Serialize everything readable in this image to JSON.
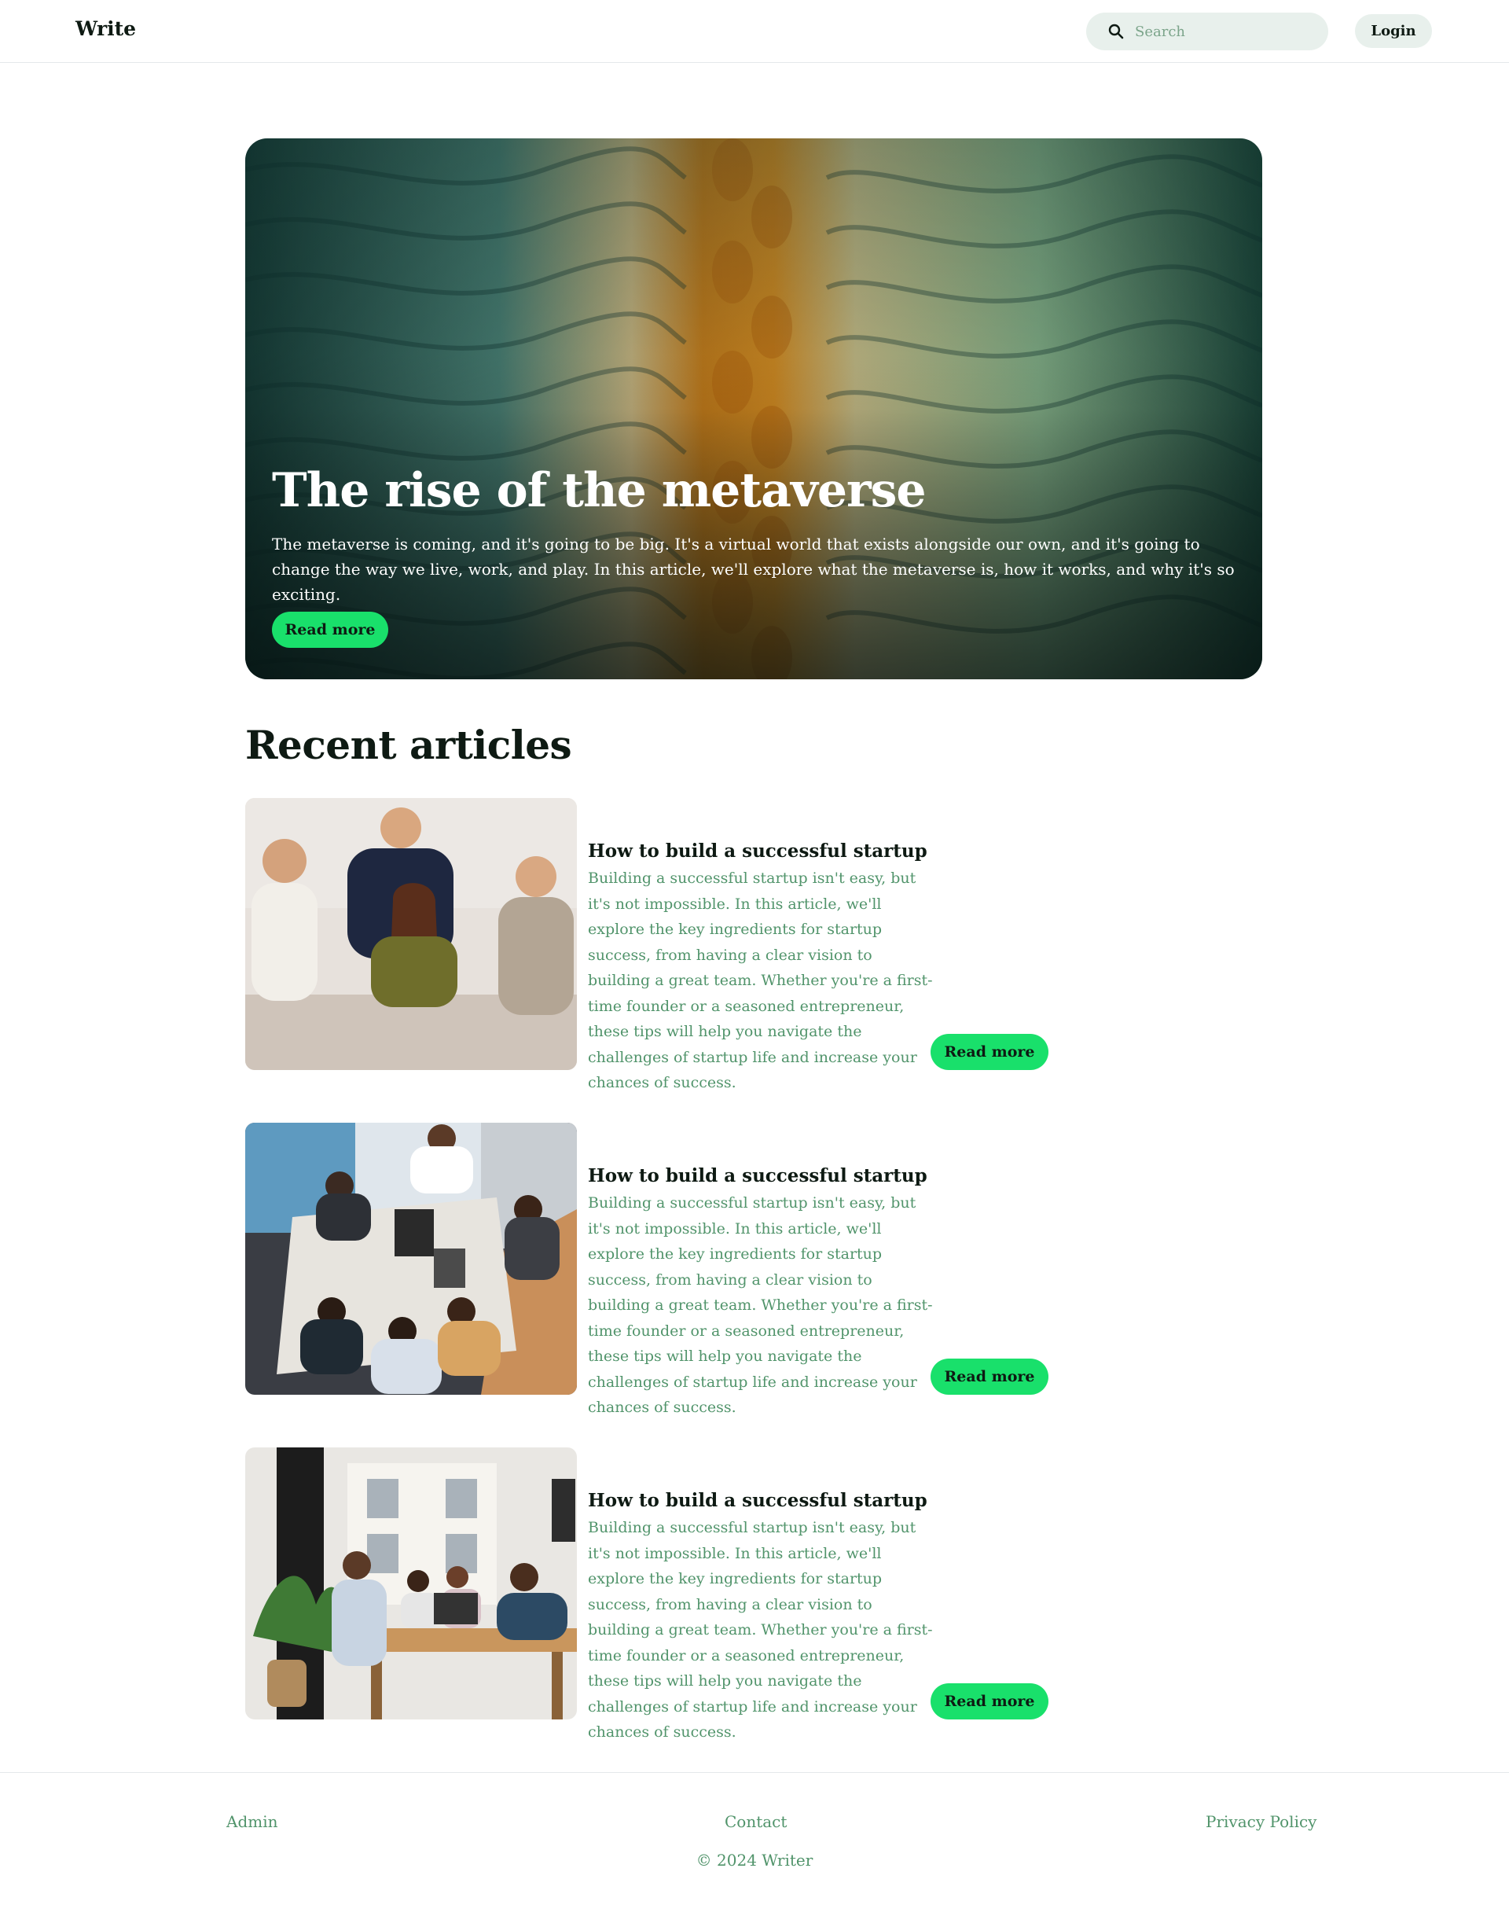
{
  "header": {
    "logo": "Write",
    "search_placeholder": "Search",
    "login_label": "Login"
  },
  "hero": {
    "title": "The rise of the metaverse",
    "description": "The metaverse is coming, and it's going to be big. It's a virtual world that exists alongside our own, and it's going to change the way we live, work, and play. In this article, we'll explore what the metaverse is, how it works, and why it's so exciting.",
    "button_label": "Read more"
  },
  "recent": {
    "heading": "Recent articles",
    "articles": [
      {
        "title": "How to build a successful startup",
        "body": "Building a successful startup isn't easy, but it's not impossible. In this article, we'll explore the key ingredients for startup success, from having a clear vision to building a great team. Whether you're a first-time founder or a seasoned entrepreneur, these tips will help you navigate the challenges of startup life and increase your chances of success.",
        "button_label": "Read more"
      },
      {
        "title": "How to build a successful startup",
        "body": "Building a successful startup isn't easy, but it's not impossible. In this article, we'll explore the key ingredients for startup success, from having a clear vision to building a great team. Whether you're a first-time founder or a seasoned entrepreneur, these tips will help you navigate the challenges of startup life and increase your chances of success.",
        "button_label": "Read more"
      },
      {
        "title": "How to build a successful startup",
        "body": "Building a successful startup isn't easy, but it's not impossible. In this article, we'll explore the key ingredients for startup success, from having a clear vision to building a great team. Whether you're a first-time founder or a seasoned entrepreneur, these tips will help you navigate the challenges of startup life and increase your chances of success.",
        "button_label": "Read more"
      }
    ]
  },
  "footer": {
    "links": [
      "Admin",
      "Contact",
      "Privacy Policy"
    ],
    "copyright": "© 2024 Writer"
  },
  "colors": {
    "accent": "#19e06b",
    "muted_text": "#51946b",
    "chip_bg": "#e8f0ec",
    "text": "#0e1a13"
  }
}
